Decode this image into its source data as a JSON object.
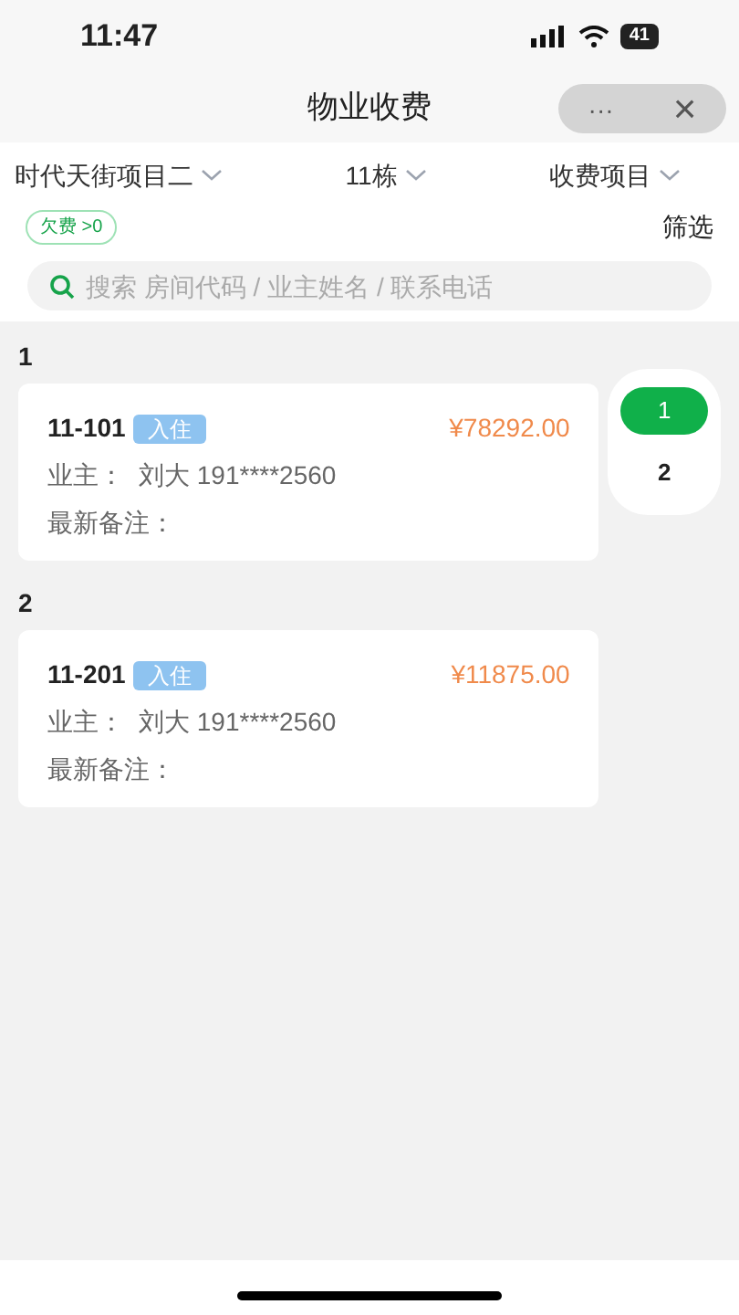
{
  "status_bar": {
    "time": "11:47",
    "battery": "41"
  },
  "nav": {
    "title": "物业收费",
    "more": "···",
    "close": "×"
  },
  "filters": [
    {
      "label": "时代天街项目二"
    },
    {
      "label": "11栋"
    },
    {
      "label": "收费项目"
    }
  ],
  "tag": {
    "label": "欠费 >0"
  },
  "filter_button": "筛选",
  "search": {
    "placeholder": "搜索 房间代码 / 业主姓名 / 联系电话"
  },
  "groups": [
    {
      "header": "1",
      "rooms": [
        {
          "code": "11-101",
          "status": "入住",
          "amount": "¥78292.00",
          "owner_label": "业主：",
          "owner": "刘大 191****2560",
          "note_label": "最新备注："
        }
      ]
    },
    {
      "header": "2",
      "rooms": [
        {
          "code": "11-201",
          "status": "入住",
          "amount": "¥11875.00",
          "owner_label": "业主：",
          "owner": "刘大 191****2560",
          "note_label": "最新备注："
        }
      ]
    }
  ],
  "index": [
    {
      "label": "1",
      "selected": true
    },
    {
      "label": "2",
      "selected": false
    }
  ]
}
